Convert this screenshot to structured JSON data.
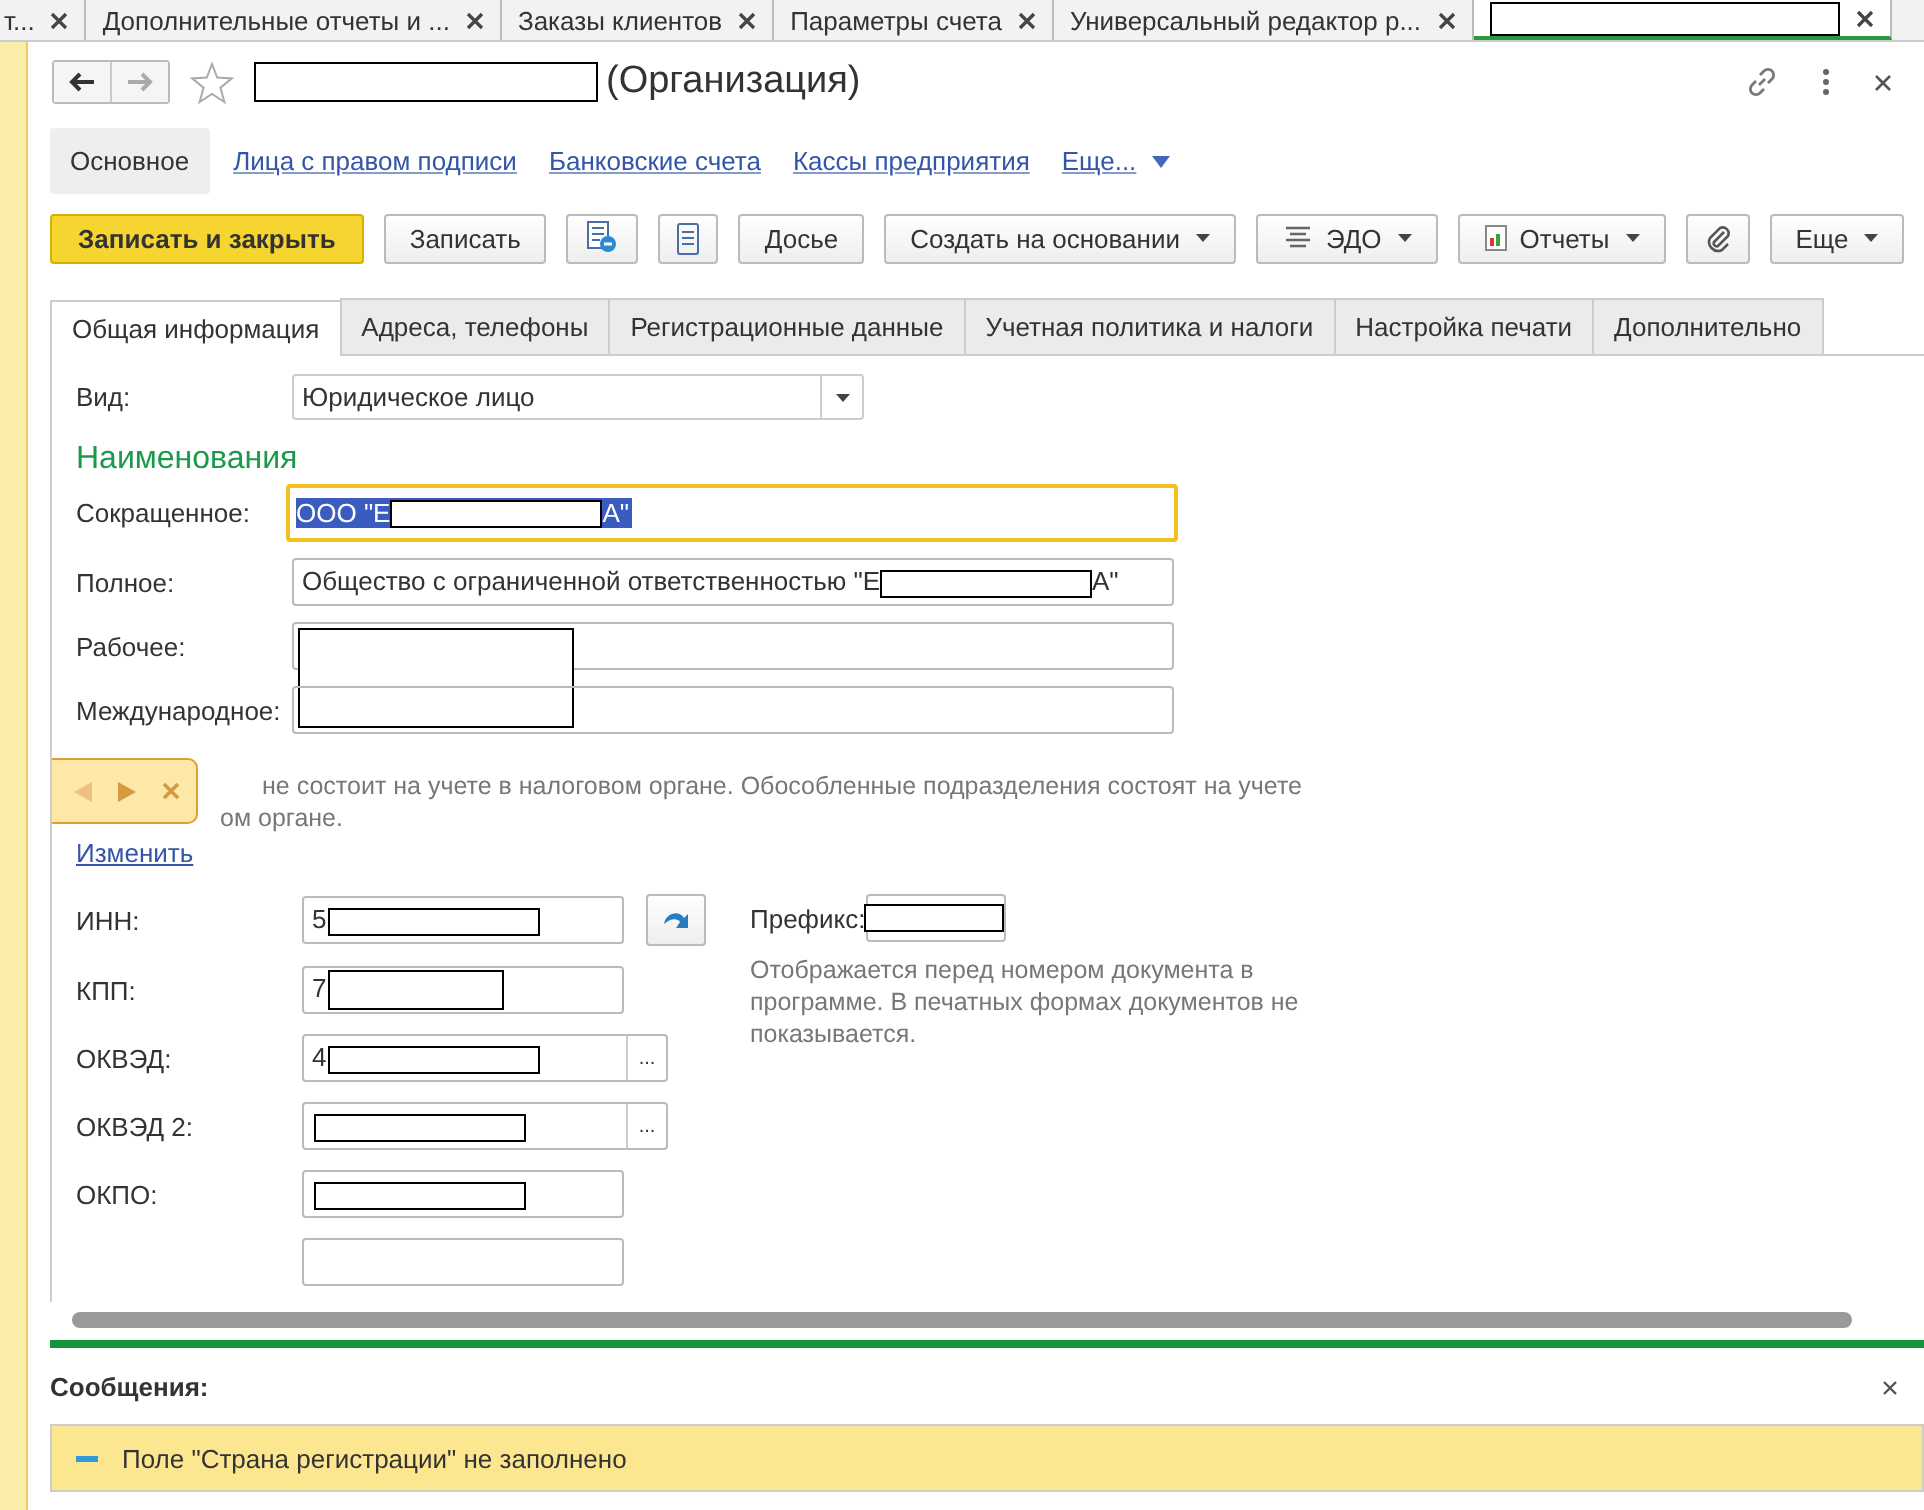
{
  "open_tabs": [
    {
      "label": "т...",
      "selected": false
    },
    {
      "label": "Дополнительные отчеты и ...",
      "selected": false
    },
    {
      "label": "Заказы клиентов",
      "selected": false
    },
    {
      "label": "Параметры счета",
      "selected": false
    },
    {
      "label": "Универсальный редактор р...",
      "selected": false
    },
    {
      "selected": true
    }
  ],
  "window": {
    "title": "(Организация)"
  },
  "nav": [
    {
      "label": "Основное",
      "selected": true
    },
    {
      "label": "Лица с правом подписи",
      "selected": false
    },
    {
      "label": "Банковские счета",
      "selected": false
    },
    {
      "label": "Кассы предприятия",
      "selected": false
    },
    {
      "label": "Еще...",
      "selected": false,
      "kind": "more"
    }
  ],
  "toolbar": [
    {
      "kind": "primary",
      "label": "Записать и закрыть"
    },
    {
      "kind": "button",
      "label": "Записать"
    },
    {
      "kind": "icon"
    },
    {
      "kind": "icon"
    },
    {
      "kind": "button",
      "label": "Досье"
    },
    {
      "kind": "dropdown",
      "label": "Создать на основании"
    },
    {
      "kind": "dropdown",
      "label": "ЭДО"
    },
    {
      "kind": "dropdown",
      "label": "Отчеты"
    },
    {
      "kind": "icon"
    },
    {
      "kind": "dropdown",
      "label": "Еще"
    }
  ],
  "tabs": [
    {
      "label": "Общая информация",
      "selected": true
    },
    {
      "label": "Адреса, телефоны",
      "selected": false
    },
    {
      "label": "Регистрационные данные",
      "selected": false
    },
    {
      "label": "Учетная политика и налоги",
      "selected": false
    },
    {
      "label": "Настройка печати",
      "selected": false
    },
    {
      "label": "Дополнительно",
      "selected": false
    }
  ],
  "kind_field": {
    "label": "Вид:",
    "value": "Юридическое лицо"
  },
  "names": {
    "heading": "Наименования",
    "fields": [
      {
        "label": "Сокращенное:",
        "value": "ООО \"Е",
        "suffix": "А\"",
        "focused": true
      },
      {
        "label": "Полное:",
        "value": "Общество с ограниченной ответственностью \"Е",
        "suffix": "А\"",
        "focused": false
      },
      {
        "label": "Рабочее:",
        "focused": false
      },
      {
        "label": "Международное:",
        "focused": false
      }
    ]
  },
  "note": {
    "lines": [
      "не состоит на учете в налоговом органе. Обособленные подразделения состоят на учете",
      "ом органе."
    ],
    "link": "Изменить"
  },
  "codes": [
    {
      "label": "ИНН:",
      "value": "5",
      "kind": "fill"
    },
    {
      "label": "КПП:",
      "value": "7",
      "kind": "plain"
    },
    {
      "label": "ОКВЭД:",
      "value": "4",
      "kind": "choice",
      "choice_button": "..."
    },
    {
      "label": "ОКВЭД 2:",
      "kind": "choice",
      "choice_button": "..."
    },
    {
      "label": "ОКПО:",
      "kind": "plain"
    }
  ],
  "prefix": {
    "label": "Префикс:",
    "hint": "Отображается перед номером документа в программе. В печатных формах документов не показывается."
  },
  "messages": {
    "title": "Сообщения:",
    "items": [
      "Поле \"Страна регистрации\" не заполнено"
    ]
  }
}
